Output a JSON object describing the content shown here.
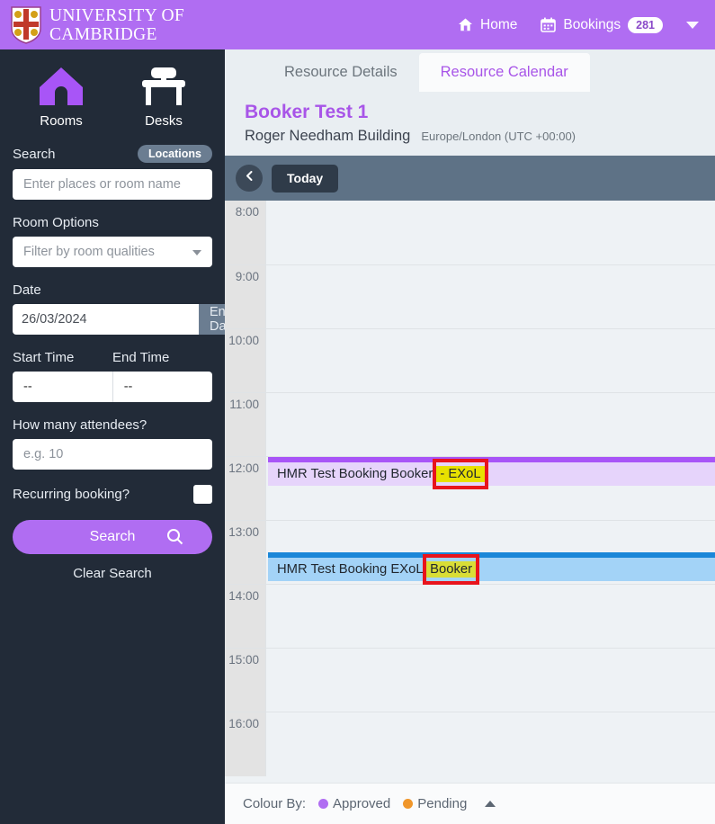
{
  "topbar": {
    "brand_line1": "University of",
    "brand_line2": "Cambridge",
    "crest_icon": "cambridge-crest",
    "home_label": "Home",
    "home_icon": "home-icon",
    "bookings_label": "Bookings",
    "bookings_icon": "calendar-icon",
    "bookings_count": "281",
    "menu_caret_icon": "chevron-down-icon",
    "background_color": "#b06df2"
  },
  "sidebar": {
    "modes": [
      {
        "label": "Rooms",
        "icon": "house-icon",
        "active": true
      },
      {
        "label": "Desks",
        "icon": "desk-icon",
        "active": false
      }
    ],
    "search_label": "Search",
    "locations_pill": "Locations",
    "search_placeholder": "Enter places or room name",
    "search_value": "",
    "room_options_label": "Room Options",
    "room_filter_placeholder": "Filter by room qualities",
    "date_label": "Date",
    "date_value": "26/03/2024",
    "end_date_label": "End Date",
    "end_date_plus": "+",
    "start_time_label": "Start Time",
    "start_time_value": "--",
    "end_time_label": "End Time",
    "end_time_value": "--",
    "attendees_label": "How many attendees?",
    "attendees_placeholder": "e.g. 10",
    "recurring_label": "Recurring booking?",
    "recurring_checked": false,
    "search_button": "Search",
    "search_button_icon": "magnifier-icon",
    "clear_search": "Clear Search"
  },
  "main": {
    "tabs": [
      {
        "label": "Resource Details",
        "active": false
      },
      {
        "label": "Resource Calendar",
        "active": true
      }
    ],
    "resource_title": "Booker Test 1",
    "resource_building": "Roger Needham Building",
    "resource_timezone": "Europe/London (UTC +00:00)",
    "toolbar": {
      "prev_icon": "chevron-left-icon",
      "today_label": "Today"
    },
    "calendar": {
      "hours": [
        "8:00",
        "9:00",
        "10:00",
        "11:00",
        "12:00",
        "13:00",
        "14:00",
        "15:00",
        "16:00"
      ],
      "events": [
        {
          "text_before": "HMR Test Booking Booker ",
          "highlight": "- EXoL",
          "text_after": "",
          "top_bar_color": "#a855f7",
          "body_color": "#e6d4fb",
          "highlighted_translucent": false
        },
        {
          "text_before": "HMR Test Booking EXoL ",
          "highlight": "Booker",
          "text_after": "",
          "top_bar_color": "#1a87d8",
          "body_color": "#a3d3f7",
          "highlighted_translucent": true
        }
      ]
    },
    "footer": {
      "colour_by_label": "Colour By:",
      "legend": [
        {
          "label": "Approved",
          "color": "#b06df2"
        },
        {
          "label": "Pending",
          "color": "#f0962a"
        }
      ],
      "collapse_icon": "caret-up-icon"
    }
  }
}
